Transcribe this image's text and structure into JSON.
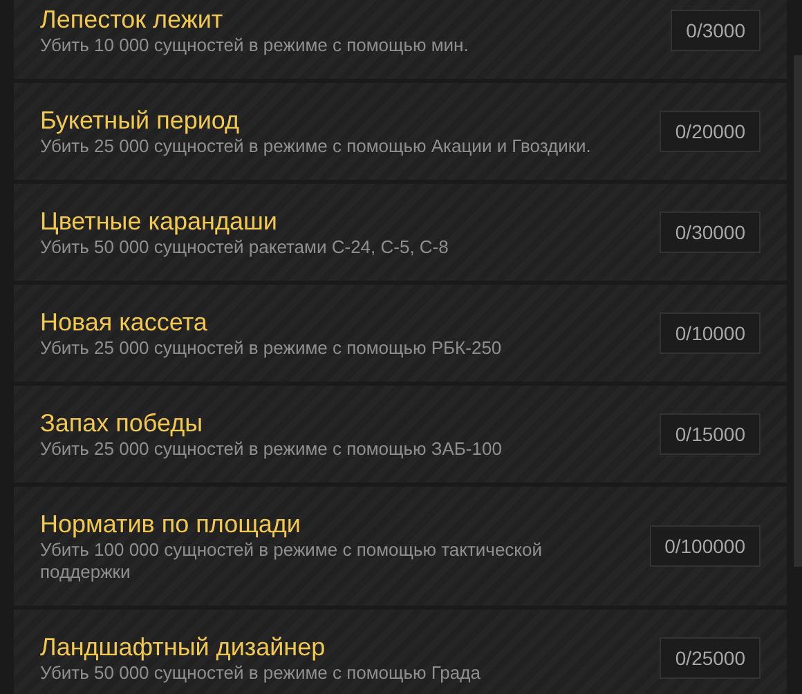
{
  "achievements": [
    {
      "title": "Лепесток лежит",
      "description": "Убить 10 000 сущностей в режиме с помощью мин.",
      "progress": "0/3000"
    },
    {
      "title": "Букетный период",
      "description": "Убить 25 000 сущностей в режиме с помощью Акации и Гвоздики.",
      "progress": "0/20000"
    },
    {
      "title": "Цветные карандаши",
      "description": "Убить 50 000 сущностей ракетами С-24, С-5, С-8",
      "progress": "0/30000"
    },
    {
      "title": "Новая кассета",
      "description": "Убить 25 000 сущностей в режиме с помощью РБК-250",
      "progress": "0/10000"
    },
    {
      "title": "Запах победы",
      "description": "Убить 25 000 сущностей в режиме с помощью ЗАБ-100",
      "progress": "0/15000"
    },
    {
      "title": "Норматив по площади",
      "description": "Убить 100 000 сущностей в режиме с помощью тактической поддержки",
      "progress": "0/100000"
    },
    {
      "title": "Ландшафтный дизайнер",
      "description": "Убить 50 000 сущностей в режиме с помощью Града",
      "progress": "0/25000"
    }
  ]
}
